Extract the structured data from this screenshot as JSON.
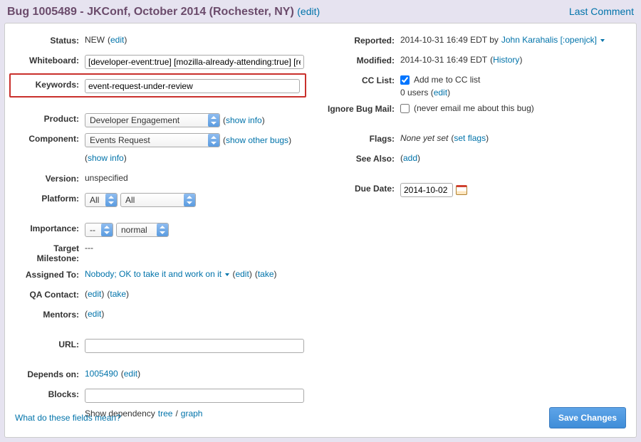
{
  "header": {
    "title_prefix": "Bug 1005489 -",
    "title_main": "JKConf, October 2014 (Rochester, NY)",
    "edit": "(edit)",
    "last_comment": "Last Comment"
  },
  "left": {
    "status": {
      "label": "Status:",
      "value": "NEW",
      "edit": "edit"
    },
    "whiteboard": {
      "label": "Whiteboard:",
      "value": "[developer-event:true] [mozilla-already-attending:true] [request-under-review]"
    },
    "keywords": {
      "label": "Keywords:",
      "value": "event-request-under-review"
    },
    "product": {
      "label": "Product:",
      "value": "Developer Engagement",
      "show_info": "show info"
    },
    "component": {
      "label": "Component:",
      "value": "Events Request",
      "show_other": "show other bugs",
      "show_info": "show info"
    },
    "version": {
      "label": "Version:",
      "value": "unspecified"
    },
    "platform": {
      "label": "Platform:",
      "val1": "All",
      "val2": "All"
    },
    "importance": {
      "label": "Importance:",
      "val1": "--",
      "val2": "normal"
    },
    "target_milestone": {
      "label": "Target Milestone:",
      "value": "---"
    },
    "assigned_to": {
      "label": "Assigned To:",
      "value": "Nobody; OK to take it and work on it",
      "edit": "edit",
      "take": "take"
    },
    "qa_contact": {
      "label": "QA Contact:",
      "edit": "edit",
      "take": "take"
    },
    "mentors": {
      "label": "Mentors:",
      "edit": "edit"
    },
    "url": {
      "label": "URL:",
      "value": ""
    },
    "depends_on": {
      "label": "Depends on:",
      "value": "1005490",
      "edit": "edit"
    },
    "blocks": {
      "label": "Blocks:",
      "value": ""
    },
    "dependency": {
      "text": "Show dependency",
      "tree": "tree",
      "sep": "/",
      "graph": "graph"
    }
  },
  "right": {
    "reported": {
      "label": "Reported:",
      "text": "2014-10-31 16:49 EDT by",
      "user": "John Karahalis [:openjck]"
    },
    "modified": {
      "label": "Modified:",
      "text": "2014-10-31 16:49 EDT",
      "history": "History"
    },
    "cc_list": {
      "label": "CC List:",
      "add_me": "Add me to CC list",
      "users": "0 users",
      "edit": "edit"
    },
    "ignore": {
      "label": "Ignore Bug Mail:",
      "text": "(never email me about this bug)"
    },
    "flags": {
      "label": "Flags:",
      "text": "None yet set",
      "set": "set flags"
    },
    "see_also": {
      "label": "See Also:",
      "add": "add"
    },
    "due_date": {
      "label": "Due Date:",
      "value": "2014-10-02"
    }
  },
  "footer": {
    "help": "What do these fields mean?",
    "save": "Save Changes"
  }
}
